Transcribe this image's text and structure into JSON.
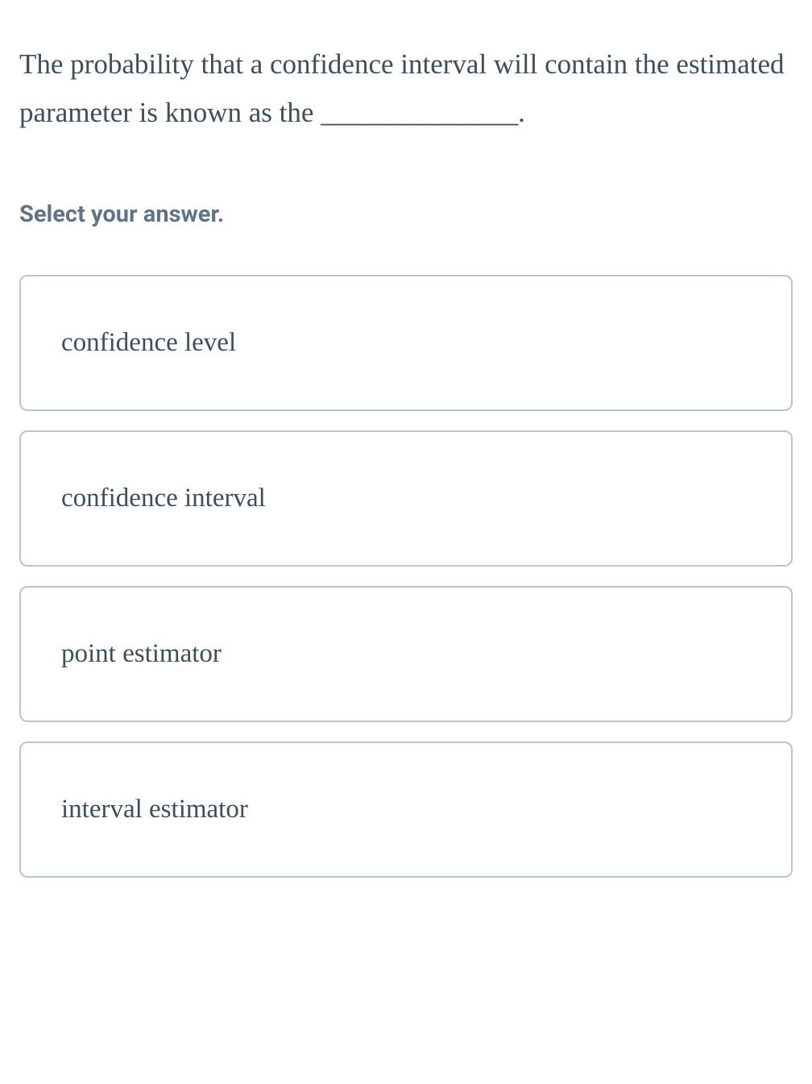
{
  "question": {
    "text": "The probability that a confidence interval will contain the estimated parameter is known as the ______________."
  },
  "instruction": "Select your answer.",
  "options": [
    {
      "label": "confidence level"
    },
    {
      "label": "confidence interval"
    },
    {
      "label": "point estimator"
    },
    {
      "label": "interval estimator"
    }
  ]
}
